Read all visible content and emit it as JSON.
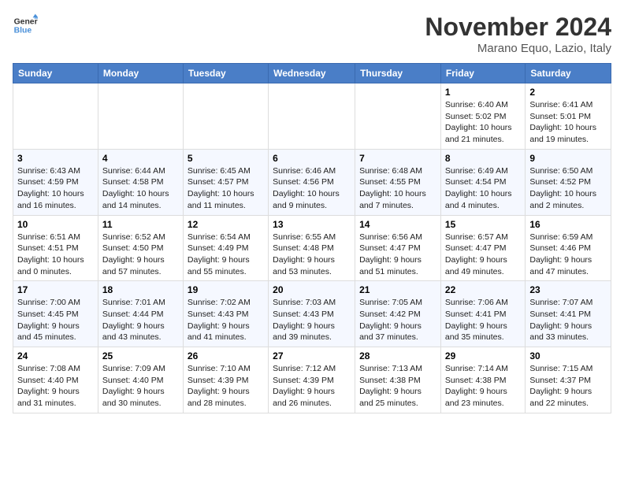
{
  "logo": {
    "line1": "General",
    "line2": "Blue"
  },
  "title": "November 2024",
  "location": "Marano Equo, Lazio, Italy",
  "days_header": [
    "Sunday",
    "Monday",
    "Tuesday",
    "Wednesday",
    "Thursday",
    "Friday",
    "Saturday"
  ],
  "weeks": [
    [
      {
        "day": "",
        "info": ""
      },
      {
        "day": "",
        "info": ""
      },
      {
        "day": "",
        "info": ""
      },
      {
        "day": "",
        "info": ""
      },
      {
        "day": "",
        "info": ""
      },
      {
        "day": "1",
        "info": "Sunrise: 6:40 AM\nSunset: 5:02 PM\nDaylight: 10 hours\nand 21 minutes."
      },
      {
        "day": "2",
        "info": "Sunrise: 6:41 AM\nSunset: 5:01 PM\nDaylight: 10 hours\nand 19 minutes."
      }
    ],
    [
      {
        "day": "3",
        "info": "Sunrise: 6:43 AM\nSunset: 4:59 PM\nDaylight: 10 hours\nand 16 minutes."
      },
      {
        "day": "4",
        "info": "Sunrise: 6:44 AM\nSunset: 4:58 PM\nDaylight: 10 hours\nand 14 minutes."
      },
      {
        "day": "5",
        "info": "Sunrise: 6:45 AM\nSunset: 4:57 PM\nDaylight: 10 hours\nand 11 minutes."
      },
      {
        "day": "6",
        "info": "Sunrise: 6:46 AM\nSunset: 4:56 PM\nDaylight: 10 hours\nand 9 minutes."
      },
      {
        "day": "7",
        "info": "Sunrise: 6:48 AM\nSunset: 4:55 PM\nDaylight: 10 hours\nand 7 minutes."
      },
      {
        "day": "8",
        "info": "Sunrise: 6:49 AM\nSunset: 4:54 PM\nDaylight: 10 hours\nand 4 minutes."
      },
      {
        "day": "9",
        "info": "Sunrise: 6:50 AM\nSunset: 4:52 PM\nDaylight: 10 hours\nand 2 minutes."
      }
    ],
    [
      {
        "day": "10",
        "info": "Sunrise: 6:51 AM\nSunset: 4:51 PM\nDaylight: 10 hours\nand 0 minutes."
      },
      {
        "day": "11",
        "info": "Sunrise: 6:52 AM\nSunset: 4:50 PM\nDaylight: 9 hours\nand 57 minutes."
      },
      {
        "day": "12",
        "info": "Sunrise: 6:54 AM\nSunset: 4:49 PM\nDaylight: 9 hours\nand 55 minutes."
      },
      {
        "day": "13",
        "info": "Sunrise: 6:55 AM\nSunset: 4:48 PM\nDaylight: 9 hours\nand 53 minutes."
      },
      {
        "day": "14",
        "info": "Sunrise: 6:56 AM\nSunset: 4:47 PM\nDaylight: 9 hours\nand 51 minutes."
      },
      {
        "day": "15",
        "info": "Sunrise: 6:57 AM\nSunset: 4:47 PM\nDaylight: 9 hours\nand 49 minutes."
      },
      {
        "day": "16",
        "info": "Sunrise: 6:59 AM\nSunset: 4:46 PM\nDaylight: 9 hours\nand 47 minutes."
      }
    ],
    [
      {
        "day": "17",
        "info": "Sunrise: 7:00 AM\nSunset: 4:45 PM\nDaylight: 9 hours\nand 45 minutes."
      },
      {
        "day": "18",
        "info": "Sunrise: 7:01 AM\nSunset: 4:44 PM\nDaylight: 9 hours\nand 43 minutes."
      },
      {
        "day": "19",
        "info": "Sunrise: 7:02 AM\nSunset: 4:43 PM\nDaylight: 9 hours\nand 41 minutes."
      },
      {
        "day": "20",
        "info": "Sunrise: 7:03 AM\nSunset: 4:43 PM\nDaylight: 9 hours\nand 39 minutes."
      },
      {
        "day": "21",
        "info": "Sunrise: 7:05 AM\nSunset: 4:42 PM\nDaylight: 9 hours\nand 37 minutes."
      },
      {
        "day": "22",
        "info": "Sunrise: 7:06 AM\nSunset: 4:41 PM\nDaylight: 9 hours\nand 35 minutes."
      },
      {
        "day": "23",
        "info": "Sunrise: 7:07 AM\nSunset: 4:41 PM\nDaylight: 9 hours\nand 33 minutes."
      }
    ],
    [
      {
        "day": "24",
        "info": "Sunrise: 7:08 AM\nSunset: 4:40 PM\nDaylight: 9 hours\nand 31 minutes."
      },
      {
        "day": "25",
        "info": "Sunrise: 7:09 AM\nSunset: 4:40 PM\nDaylight: 9 hours\nand 30 minutes."
      },
      {
        "day": "26",
        "info": "Sunrise: 7:10 AM\nSunset: 4:39 PM\nDaylight: 9 hours\nand 28 minutes."
      },
      {
        "day": "27",
        "info": "Sunrise: 7:12 AM\nSunset: 4:39 PM\nDaylight: 9 hours\nand 26 minutes."
      },
      {
        "day": "28",
        "info": "Sunrise: 7:13 AM\nSunset: 4:38 PM\nDaylight: 9 hours\nand 25 minutes."
      },
      {
        "day": "29",
        "info": "Sunrise: 7:14 AM\nSunset: 4:38 PM\nDaylight: 9 hours\nand 23 minutes."
      },
      {
        "day": "30",
        "info": "Sunrise: 7:15 AM\nSunset: 4:37 PM\nDaylight: 9 hours\nand 22 minutes."
      }
    ]
  ]
}
